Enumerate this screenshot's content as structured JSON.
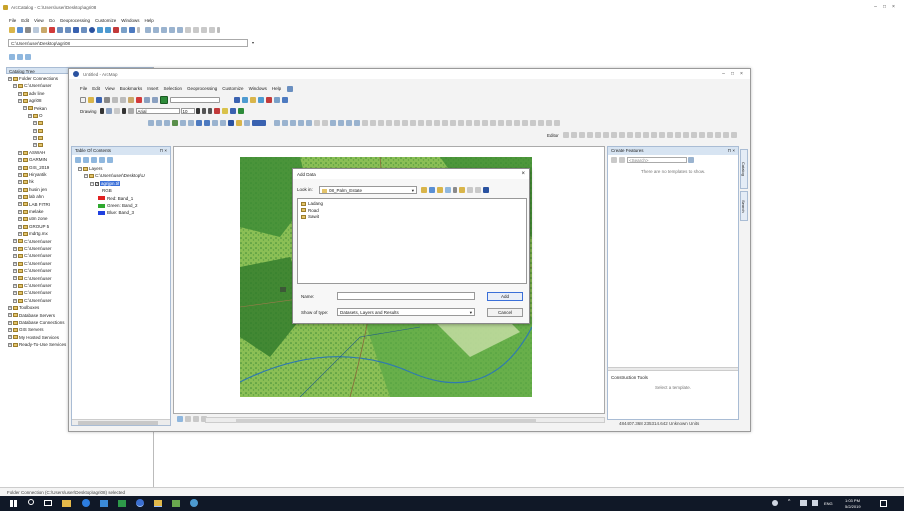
{
  "catalog": {
    "title": "ArcCatalog - C:\\Users\\user\\Desktop\\agri08",
    "menu": [
      "File",
      "Edit",
      "View",
      "Go",
      "Geoprocessing",
      "Customize",
      "Windows",
      "Help"
    ],
    "location": "C:\\Users\\user\\Desktop\\agri08",
    "tree_title": "Catalog Tree",
    "tree_items": [
      {
        "indent": 0,
        "label": "Folder Connections"
      },
      {
        "indent": 1,
        "label": "C:\\Users\\user"
      },
      {
        "indent": 2,
        "label": "adv line"
      },
      {
        "indent": 2,
        "label": "agri08"
      },
      {
        "indent": 3,
        "label": "Pekan"
      },
      {
        "indent": 4,
        "label": "O"
      },
      {
        "indent": 5,
        "label": ""
      },
      {
        "indent": 5,
        "label": ""
      },
      {
        "indent": 5,
        "label": ""
      },
      {
        "indent": 5,
        "label": ""
      },
      {
        "indent": 2,
        "label": "ASWAH"
      },
      {
        "indent": 2,
        "label": "GARMIN"
      },
      {
        "indent": 2,
        "label": "GIS_2019"
      },
      {
        "indent": 2,
        "label": "Hiryantik"
      },
      {
        "indent": 2,
        "label": "hk"
      },
      {
        "indent": 2,
        "label": "husin jen"
      },
      {
        "indent": 2,
        "label": "lab ahn"
      },
      {
        "indent": 2,
        "label": "LAB FITRI"
      },
      {
        "indent": 2,
        "label": "melake"
      },
      {
        "indent": 2,
        "label": "utm zone"
      },
      {
        "indent": 2,
        "label": "GROUP 5"
      },
      {
        "indent": 2,
        "label": "mdrtg.mx"
      },
      {
        "indent": 1,
        "label": "C:\\Users\\user"
      },
      {
        "indent": 1,
        "label": "C:\\Users\\user"
      },
      {
        "indent": 1,
        "label": "C:\\Users\\user"
      },
      {
        "indent": 1,
        "label": "C:\\Users\\user"
      },
      {
        "indent": 1,
        "label": "C:\\Users\\user"
      },
      {
        "indent": 1,
        "label": "C:\\Users\\user"
      },
      {
        "indent": 1,
        "label": "C:\\Users\\user"
      },
      {
        "indent": 1,
        "label": "C:\\Users\\user"
      },
      {
        "indent": 1,
        "label": "C:\\Users\\user"
      },
      {
        "indent": 0,
        "label": "Toolboxes"
      },
      {
        "indent": 0,
        "label": "Database Servers"
      },
      {
        "indent": 0,
        "label": "Database Connections"
      },
      {
        "indent": 0,
        "label": "GIS Servers"
      },
      {
        "indent": 0,
        "label": "My Hosted Services"
      },
      {
        "indent": 0,
        "label": "Ready-To-Use Services"
      }
    ],
    "status": "Folder Connection (C:\\Users\\user\\Desktop\\agri08) selected"
  },
  "arcmap": {
    "title": "Untitled - ArcMap",
    "menu": [
      "File",
      "Edit",
      "View",
      "Bookmarks",
      "Insert",
      "Selection",
      "Geoprocessing",
      "Customize",
      "Windows",
      "Help"
    ],
    "drawing_label": "Drawing",
    "font_name": "Arial",
    "font_size": "10",
    "editor_label": "Editor",
    "toc": {
      "title": "Table Of Contents",
      "layers_label": "Layers",
      "path": "C:\\Users\\user\\Desktop\\U",
      "layer_name": "agrijpn.tif",
      "rgb_label": "RGB",
      "bands": [
        {
          "label": "Red: Band_1",
          "color": "#e02020"
        },
        {
          "label": "Green: Band_2",
          "color": "#2fa82f"
        },
        {
          "label": "Blue: Band_3",
          "color": "#2040e0"
        }
      ]
    },
    "create_features": {
      "title": "Create Features",
      "search_placeholder": "<Search>",
      "empty_text": "There are no templates to show.",
      "construction_title": "Construction Tools",
      "construction_text": "Select a template."
    },
    "side_tabs": [
      "Catalog",
      "Search"
    ],
    "coords": "484407.368 235314.642 Unknown Units"
  },
  "dialog": {
    "title": "Add Data",
    "look_in_label": "Look in:",
    "look_in_value": "08_Palm_Estate",
    "files": [
      "Ladang",
      "Road",
      "Sawit"
    ],
    "name_label": "Name:",
    "name_value": "",
    "show_type_label": "Show of type:",
    "show_type_value": "Datasets, Layers and Results",
    "add_label": "Add",
    "cancel_label": "Cancel",
    "close_glyph": "×"
  },
  "taskbar": {
    "lang": "ENG",
    "time": "1:03 PM",
    "date": "5/2/2019"
  },
  "colors": {
    "map_dark": "#2e7a2a",
    "map_light": "#9bc85a",
    "selection": "#3a6fd8",
    "taskbar": "#101827"
  }
}
